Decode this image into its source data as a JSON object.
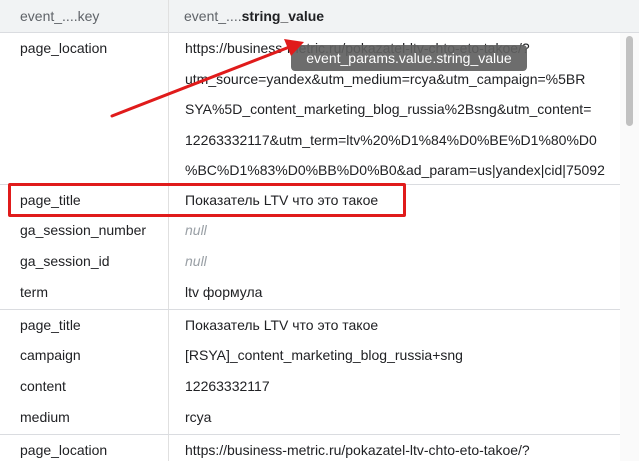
{
  "header": {
    "key_col_prefix": "event_....",
    "key_col_suffix": "key",
    "value_col_prefix": "event_....",
    "value_col_suffix": "string_value"
  },
  "tooltip": "event_params.value.string_value",
  "rows": {
    "r1": {
      "key": "page_location",
      "lines": [
        "https://business-metric.ru/pokazatel-ltv-chto-eto-takoe/?",
        "utm_source=yandex&utm_medium=rcya&utm_campaign=%5BR",
        "SYA%5D_content_marketing_blog_russia%2Bsng&utm_content=",
        "12263332117&utm_term=ltv%20%D1%84%D0%BE%D1%80%D0",
        "%BC%D1%83%D0%BB%D0%B0&ad_param=us|yandex|cid|75092"
      ]
    },
    "r2": {
      "key": "page_title",
      "value": "Показатель LTV что это такое"
    },
    "r3": {
      "key": "ga_session_number",
      "value": "null"
    },
    "r4": {
      "key": "ga_session_id",
      "value": "null"
    },
    "r5": {
      "key": "term",
      "value": "ltv формула"
    },
    "r6": {
      "key": "page_title",
      "value": "Показатель LTV что это такое"
    },
    "r7": {
      "key": "campaign",
      "value": "[RSYA]_content_marketing_blog_russia+sng"
    },
    "r8": {
      "key": "content",
      "value": "12263332117"
    },
    "r9": {
      "key": "medium",
      "value": "rcya"
    },
    "r10": {
      "key": "page_location",
      "value": "https://business-metric.ru/pokazatel-ltv-chto-eto-takoe/?"
    }
  },
  "annotation": {
    "highlight_color": "#e01b1b",
    "arrow_color": "#e01b1b"
  }
}
